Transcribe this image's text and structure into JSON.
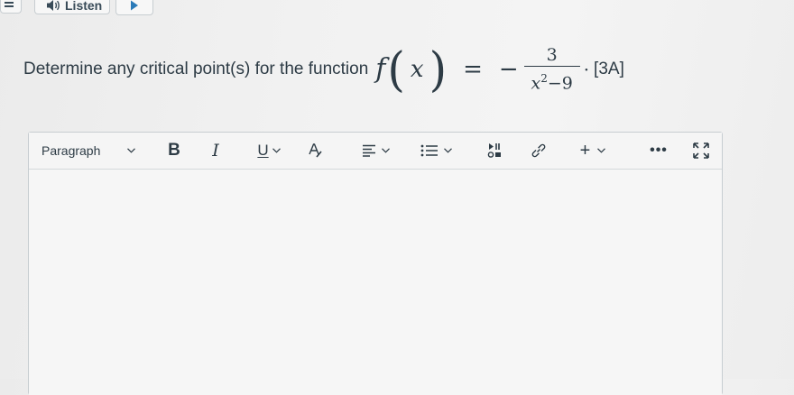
{
  "top_bar": {
    "listen_label": "Listen"
  },
  "question": {
    "text": "Determine any critical point(s) for the function",
    "math": {
      "function_name": "f",
      "variable": "x",
      "equals": "=",
      "sign": "−",
      "numerator": "3",
      "denominator_base": "x",
      "denominator_exponent": "2",
      "denominator_rest": "−9",
      "trailing": "·"
    },
    "marks": "[3A]"
  },
  "editor": {
    "block_format": "Paragraph",
    "bold_label": "B",
    "italic_label": "I",
    "underline_label": "U",
    "insert_label": "+",
    "more_label": "•••",
    "body_text": ""
  },
  "colors": {
    "text": "#2d3b45",
    "border": "#c7cdd1",
    "background": "#f2f2f2"
  }
}
